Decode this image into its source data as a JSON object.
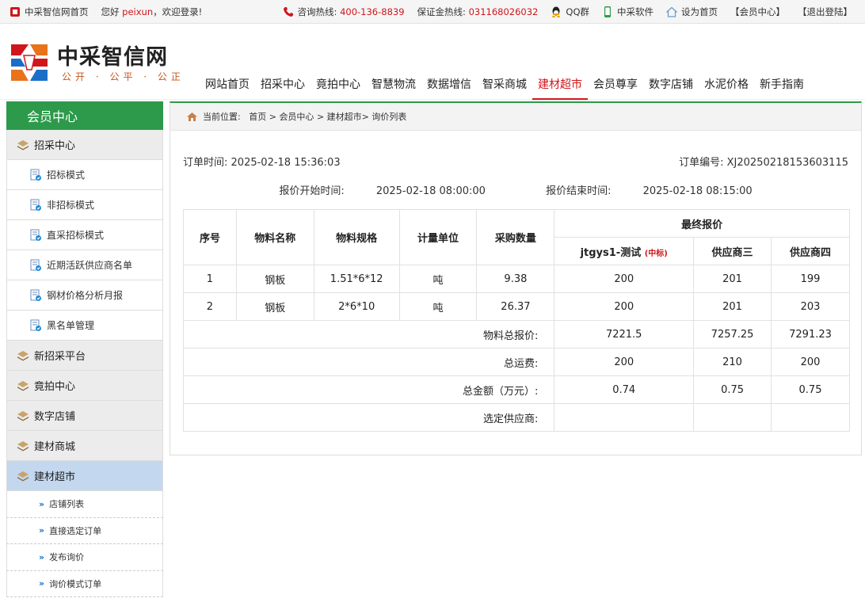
{
  "topbar": {
    "site_home": "中采智信网首页",
    "greeting_prefix": "您好",
    "username": "peixun",
    "greeting_suffix": "，欢迎登录!",
    "hotline_label": "咨询热线:",
    "hotline": "400-136-8839",
    "deposit_label": "保证金热线:",
    "deposit": "031168026032",
    "qq": "QQ群",
    "software": "中采软件",
    "set_home": "设为首页",
    "member": "【会员中心】",
    "logout": "【退出登陆】"
  },
  "logo": {
    "title": "中采智信网",
    "slogan": "公开 · 公平 · 公正"
  },
  "nav": [
    "网站首页",
    "招采中心",
    "竟拍中心",
    "智慧物流",
    "数据增信",
    "智采商城",
    "建材超市",
    "会员尊享",
    "数字店铺",
    "水泥价格",
    "新手指南"
  ],
  "nav_active_index": 6,
  "sidebar": {
    "title": "会员中心",
    "cat1": "招采中心",
    "cat1_items": [
      "招标模式",
      "非招标模式",
      "直采招标模式",
      "近期活跃供应商名单",
      "钢材价格分析月报",
      "黑名单管理"
    ],
    "cat2": "新招采平台",
    "cat3": "竟拍中心",
    "cat4": "数字店铺",
    "cat5": "建材商城",
    "cat6": "建材超市",
    "cat6_items": [
      "店铺列表",
      "直接选定订单",
      "发布询价",
      "询价模式订单"
    ]
  },
  "breadcrumb": {
    "label": "当前位置:",
    "home": "首页",
    "sep1": ">",
    "member": "会员中心",
    "sep2": ">",
    "section": "建材超市",
    "page": "> 询价列表"
  },
  "order": {
    "time_label": "订单时间:",
    "time": "2025-02-18 15:36:03",
    "no_label": "订单编号:",
    "no": "XJ20250218153603115",
    "start_label": "报价开始时间:",
    "start": "2025-02-18 08:00:00",
    "end_label": "报价结束时间:",
    "end": "2025-02-18 08:15:00"
  },
  "table": {
    "headers": {
      "seq": "序号",
      "name": "物料名称",
      "spec": "物料规格",
      "unit": "计量单位",
      "qty": "采购数量",
      "final": "最终报价"
    },
    "suppliers": [
      {
        "name": "jtgys1-测试",
        "tag": "(中标)"
      },
      {
        "name": "供应商三",
        "tag": ""
      },
      {
        "name": "供应商四",
        "tag": ""
      }
    ],
    "rows": [
      {
        "seq": "1",
        "name": "钢板",
        "spec": "1.51*6*12",
        "unit": "吨",
        "qty": "9.38",
        "p1": "200",
        "p2": "201",
        "p3": "199"
      },
      {
        "seq": "2",
        "name": "钢板",
        "spec": "2*6*10",
        "unit": "吨",
        "qty": "26.37",
        "p1": "200",
        "p2": "201",
        "p3": "203"
      }
    ],
    "totals": {
      "material_label": "物料总报价:",
      "material": [
        "7221.5",
        "7257.25",
        "7291.23"
      ],
      "freight_label": "总运费:",
      "freight": [
        "200",
        "210",
        "200"
      ],
      "amount_label": "总金额（万元）:",
      "amount": [
        "0.74",
        "0.75",
        "0.75"
      ],
      "selected_label": "选定供应商:"
    }
  }
}
